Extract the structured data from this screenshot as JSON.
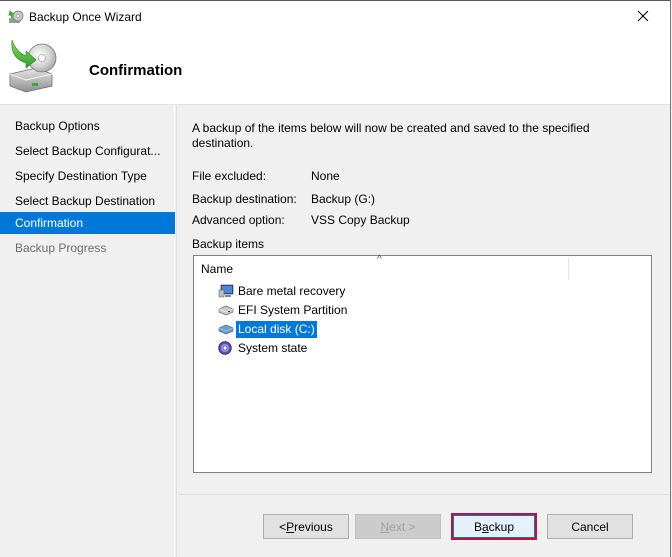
{
  "window": {
    "title": "Backup Once Wizard",
    "close_label": "Close",
    "header_title": "Confirmation"
  },
  "sidebar": {
    "items": [
      {
        "label": "Backup Options",
        "state": "normal"
      },
      {
        "label": "Select Backup Configurat...",
        "state": "normal"
      },
      {
        "label": "Specify Destination Type",
        "state": "normal"
      },
      {
        "label": "Select Backup Destination",
        "state": "normal"
      },
      {
        "label": "Confirmation",
        "state": "active"
      },
      {
        "label": "Backup Progress",
        "state": "disabled"
      }
    ]
  },
  "main": {
    "intro": "A backup of the items below will now be created and saved to the specified destination.",
    "details": [
      {
        "label": "File excluded:",
        "value": "None"
      },
      {
        "label": "Backup destination:",
        "value": "Backup (G:)"
      },
      {
        "label": "Advanced option:",
        "value": "VSS Copy Backup"
      }
    ],
    "items_label": "Backup items",
    "list": {
      "column_header": "Name",
      "sort_indicator": "^",
      "items": [
        {
          "label": "Bare metal recovery",
          "icon": "bare-metal-recovery-icon",
          "selected": false
        },
        {
          "label": "EFI System Partition",
          "icon": "drive-icon",
          "selected": false
        },
        {
          "label": "Local disk (C:)",
          "icon": "drive-icon",
          "selected": true
        },
        {
          "label": "System state",
          "icon": "system-state-icon",
          "selected": false
        }
      ]
    }
  },
  "buttons": {
    "previous": {
      "prefix": "< ",
      "accel": "P",
      "rest": "revious",
      "enabled": true
    },
    "next": {
      "accel": "N",
      "rest": "ext >",
      "enabled": false
    },
    "backup": {
      "pre": "B",
      "accel": "a",
      "rest": "ckup",
      "enabled": true,
      "highlighted": true
    },
    "cancel": {
      "label": "Cancel",
      "enabled": true
    }
  },
  "colors": {
    "accent": "#0078d7",
    "highlight_border": "#c8102e"
  }
}
